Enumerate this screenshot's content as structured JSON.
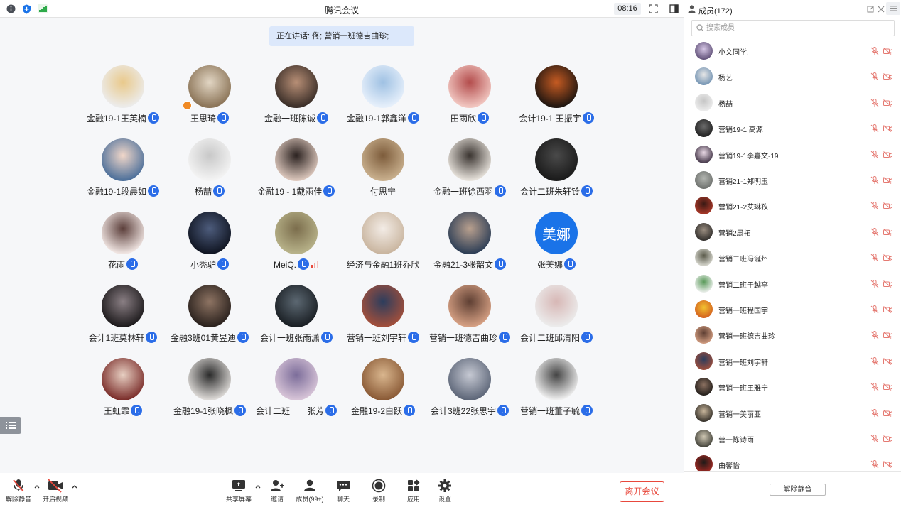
{
  "window": {
    "title": "腾讯会议",
    "clock": "08:16"
  },
  "speaking_banner": "正在讲话: 佟; 营销一班德吉曲珍;",
  "participants": [
    {
      "name": "金融19-1王英楠",
      "mic": true,
      "colors": [
        "#ececec",
        "#e9c98b"
      ]
    },
    {
      "name": "王思琦",
      "mic": true,
      "host": true,
      "colors": [
        "#8a7356",
        "#e2d6c4"
      ]
    },
    {
      "name": "金融一班陈诚",
      "mic": true,
      "colors": [
        "#3a2e28",
        "#b88f76"
      ]
    },
    {
      "name": "金融19-1郭鑫洋",
      "mic": true,
      "colors": [
        "#e7f0fb",
        "#9fc1e3"
      ]
    },
    {
      "name": "田雨欣",
      "mic": true,
      "colors": [
        "#f2c8c2",
        "#b34c4c"
      ]
    },
    {
      "name": "会计19-1 王振宇",
      "mic": true,
      "colors": [
        "#1e1510",
        "#c65b22"
      ]
    },
    {
      "name": "金融19-1段晨如",
      "mic": true,
      "colors": [
        "#4c6f9a",
        "#f1d7c9"
      ]
    },
    {
      "name": "杨喆",
      "mic": true,
      "colors": [
        "#f4f4f4",
        "#c8c8c8"
      ]
    },
    {
      "name": "金融19 - 1戴雨佳",
      "mic": true,
      "colors": [
        "#ddc8bd",
        "#2b2220"
      ]
    },
    {
      "name": "付思宁",
      "mic": false,
      "colors": [
        "#c9b08e",
        "#7d5c3b"
      ]
    },
    {
      "name": "金融一班徐西羽",
      "mic": true,
      "colors": [
        "#e8e3dc",
        "#3a3430"
      ]
    },
    {
      "name": "会计二班朱轩铃",
      "mic": true,
      "colors": [
        "#1a1a1a",
        "#4a4a4a"
      ]
    },
    {
      "name": "花雨",
      "mic": true,
      "colors": [
        "#f1e6e3",
        "#5b3e3a"
      ]
    },
    {
      "name": "小秃驴",
      "mic": true,
      "colors": [
        "#101522",
        "#4d5c7c"
      ]
    },
    {
      "name": "MeiQ.",
      "mic": true,
      "volume": true,
      "colors": [
        "#b8b38a",
        "#7b6d4c"
      ]
    },
    {
      "name": "经济与金融1班乔欣",
      "mic": false,
      "colors": [
        "#c9b59f",
        "#f3ece6"
      ]
    },
    {
      "name": "金融21-3张韶文",
      "mic": true,
      "colors": [
        "#2d3e56",
        "#b9a08e"
      ]
    },
    {
      "name": "张美娜",
      "mic": true,
      "text_avatar": "美娜",
      "colors": [
        "#1a73e8",
        "#1a73e8"
      ]
    },
    {
      "name": "会计1班莫林轩",
      "mic": true,
      "colors": [
        "#1d1a1c",
        "#8a7f84"
      ]
    },
    {
      "name": "金融3班01黄昱迪",
      "mic": true,
      "colors": [
        "#2a211d",
        "#8e7463"
      ]
    },
    {
      "name": "会计一班张雨潇",
      "mic": true,
      "colors": [
        "#1a1f24",
        "#5c6872"
      ]
    },
    {
      "name": "营销一班刘宇轩",
      "mic": true,
      "colors": [
        "#a34f3b",
        "#2c3d5d"
      ]
    },
    {
      "name": "营销一班德吉曲珍",
      "mic": true,
      "colors": [
        "#d7a184",
        "#5e3f33"
      ]
    },
    {
      "name": "会计二班邱清阳",
      "mic": true,
      "colors": [
        "#ececec",
        "#d7b7b5"
      ]
    },
    {
      "name": "王虹霏",
      "mic": true,
      "colors": [
        "#7b2e2b",
        "#e7cfc2"
      ]
    },
    {
      "name": "金融19-1张晓枫",
      "mic": true,
      "colors": [
        "#dedbd8",
        "#2a2a2a"
      ]
    },
    {
      "name": "会计二班　　张芳",
      "mic": true,
      "colors": [
        "#d8c5d8",
        "#7c6d9a"
      ]
    },
    {
      "name": "金融19-2白跃",
      "mic": true,
      "colors": [
        "#8a5a36",
        "#d9b68e"
      ]
    },
    {
      "name": "会计3班22张思宇",
      "mic": true,
      "colors": [
        "#5d6678",
        "#c6c9d3"
      ]
    },
    {
      "name": "营销一班董子毓",
      "mic": true,
      "colors": [
        "#f0f0f0",
        "#444"
      ]
    }
  ],
  "toolbar": {
    "unmute": "解除静音",
    "start_video": "开启视频",
    "share": "共享屏幕",
    "invite": "邀请",
    "members": "成员(99+)",
    "chat": "聊天",
    "record": "录制",
    "apps": "应用",
    "settings": "设置",
    "leave": "离开会议"
  },
  "panel": {
    "title": "成员(172)",
    "search_placeholder": "搜索成员",
    "unmute_all": "解除静音",
    "members": [
      {
        "name": "小文同学.",
        "colors": [
          "#5a4a72",
          "#d6c7e6"
        ]
      },
      {
        "name": "杨艺",
        "colors": [
          "#6d8fb0",
          "#e6e6e6"
        ]
      },
      {
        "name": "杨喆",
        "colors": [
          "#f0f0f0",
          "#c6c6c6"
        ]
      },
      {
        "name": "营销19-1 高源",
        "colors": [
          "#1e1e1e",
          "#6b6b6b"
        ]
      },
      {
        "name": "营销19-1李嘉文-19",
        "colors": [
          "#3a2d3f",
          "#e8d8e4"
        ]
      },
      {
        "name": "营销21-1郑明玉",
        "colors": [
          "#6a6d6a",
          "#b2b5b0"
        ]
      },
      {
        "name": "营销21-2艾琳孜",
        "colors": [
          "#b03a2a",
          "#3a1a14"
        ]
      },
      {
        "name": "营销2周拓",
        "colors": [
          "#2c2a28",
          "#9a8d80"
        ]
      },
      {
        "name": "营销二班冯诞州",
        "colors": [
          "#e0e0d8",
          "#5a5a4a"
        ]
      },
      {
        "name": "营销二班于越亭",
        "colors": [
          "#f4f4f4",
          "#5a9a5a"
        ]
      },
      {
        "name": "营销一班程国宇",
        "colors": [
          "#d25b1e",
          "#f2c230"
        ]
      },
      {
        "name": "营销一班德吉曲珍",
        "colors": [
          "#d7a184",
          "#5e3f33"
        ]
      },
      {
        "name": "营销一班刘宇轩",
        "colors": [
          "#a34f3b",
          "#2c3d5d"
        ]
      },
      {
        "name": "营销一班王雅宁",
        "colors": [
          "#1e1a17",
          "#8a7060"
        ]
      },
      {
        "name": "营销一美丽亚",
        "colors": [
          "#2e2a24",
          "#c6b49a"
        ]
      },
      {
        "name": "营一陈诗雨",
        "colors": [
          "#3a3a32",
          "#d0c8b4"
        ]
      },
      {
        "name": "由馨怡",
        "colors": [
          "#a82a24",
          "#1e1a18"
        ]
      }
    ]
  }
}
